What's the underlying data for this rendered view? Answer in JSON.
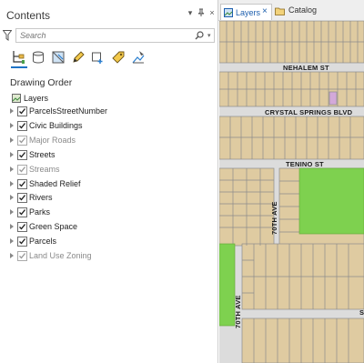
{
  "contents_pane": {
    "title": "Contents",
    "search": {
      "placeholder": "Search"
    },
    "toolbar": {
      "buttons": [
        {
          "name": "list-by-drawing-order",
          "icon": "drawing-order-icon"
        },
        {
          "name": "list-by-data-source",
          "icon": "database-icon"
        },
        {
          "name": "list-by-selection",
          "icon": "selection-icon"
        },
        {
          "name": "list-by-editing",
          "icon": "pencil-icon"
        },
        {
          "name": "list-by-snapping",
          "icon": "snapping-icon"
        },
        {
          "name": "list-by-labeling",
          "icon": "labeling-icon"
        },
        {
          "name": "list-by-perspective-imagery",
          "icon": "perspective-icon"
        }
      ]
    },
    "section_title": "Drawing Order",
    "root_label": "Layers",
    "layers": [
      {
        "label": "ParcelsStreetNumber",
        "checked": true,
        "dimmed": false
      },
      {
        "label": "Civic Buildings",
        "checked": true,
        "dimmed": false
      },
      {
        "label": "Major Roads",
        "checked": true,
        "dimmed": true
      },
      {
        "label": "Streets",
        "checked": true,
        "dimmed": false
      },
      {
        "label": "Streams",
        "checked": true,
        "dimmed": true
      },
      {
        "label": "Shaded Relief",
        "checked": true,
        "dimmed": false
      },
      {
        "label": "Rivers",
        "checked": true,
        "dimmed": false
      },
      {
        "label": "Parks",
        "checked": true,
        "dimmed": false
      },
      {
        "label": "Green Space",
        "checked": true,
        "dimmed": false
      },
      {
        "label": "Parcels",
        "checked": true,
        "dimmed": false
      },
      {
        "label": "Land Use Zoning",
        "checked": true,
        "dimmed": true
      }
    ]
  },
  "map_view": {
    "tabs": [
      {
        "label": "Layers",
        "active": true,
        "close": "×"
      },
      {
        "label": "Catalog",
        "active": false
      }
    ],
    "streets": {
      "nehalem": "NEHALEM ST",
      "crystal_springs": "CRYSTAL SPRINGS BLVD",
      "tenino": "TENINO ST",
      "ave_70_upper": "70TH AVE",
      "ave_70_lower": "70TH AVE",
      "edge_fragment": "S"
    },
    "colors": {
      "parcel_fill": "#dfcba1",
      "parcel_outline": "#8c8c8c",
      "road": "#dcdcdc",
      "green_space": "#7ed14f",
      "civic_building": "#d3a9d9"
    }
  }
}
